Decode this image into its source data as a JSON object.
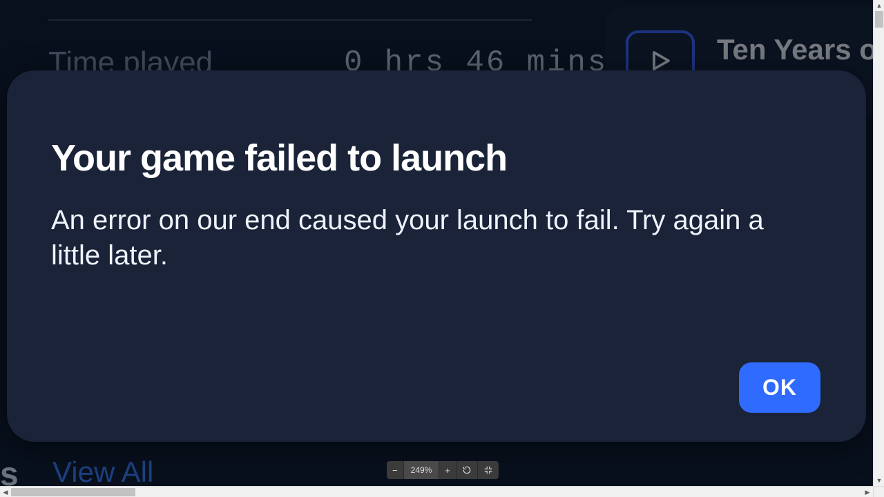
{
  "background": {
    "time_played_label": "Time played",
    "time_played_value": "0 hrs 46 mins",
    "card_title": "Ten Years of Ma",
    "view_all_label": "View All",
    "trailing_letter": "s"
  },
  "dialog": {
    "title": "Your game failed to launch",
    "body": "An error on our end caused your launch to fail. Try again a little later.",
    "ok_label": "OK"
  },
  "viewer": {
    "zoom_out": "−",
    "zoom_value": "249%",
    "zoom_in": "+"
  }
}
